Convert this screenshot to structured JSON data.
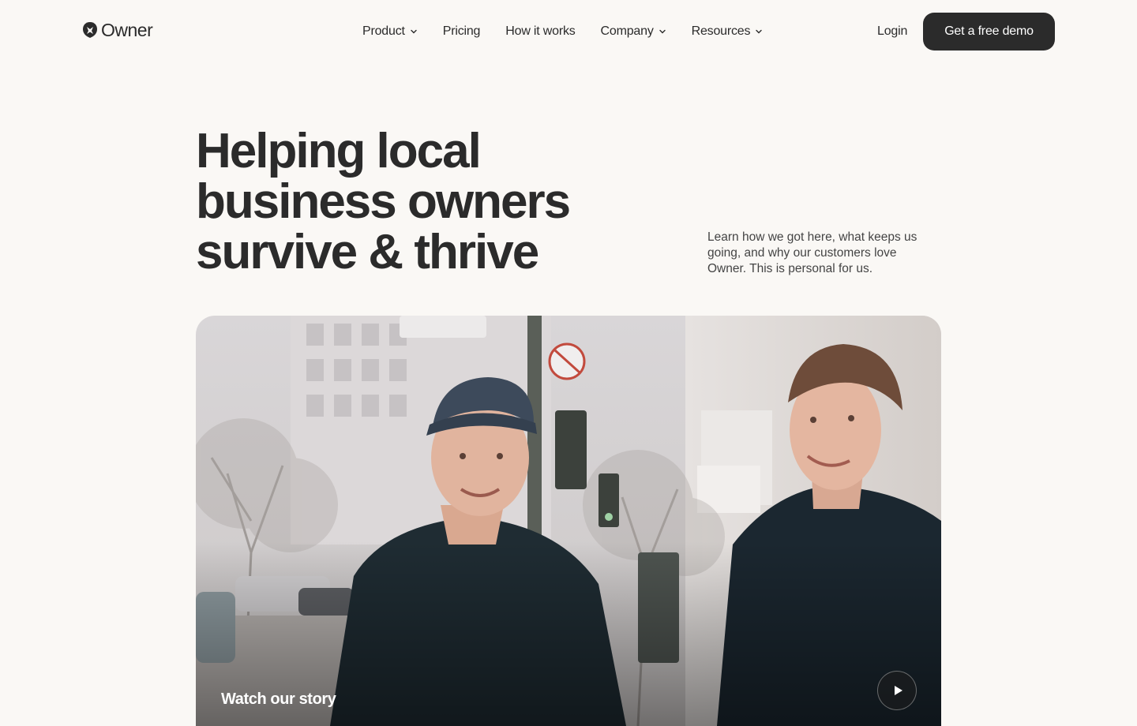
{
  "brand": {
    "name": "Owner"
  },
  "nav": {
    "items": [
      {
        "label": "Product",
        "has_dropdown": true
      },
      {
        "label": "Pricing",
        "has_dropdown": false
      },
      {
        "label": "How it works",
        "has_dropdown": false
      },
      {
        "label": "Company",
        "has_dropdown": true
      },
      {
        "label": "Resources",
        "has_dropdown": true
      }
    ],
    "login_label": "Login",
    "cta_label": "Get a free demo"
  },
  "hero": {
    "title_lines": [
      "Helping local",
      "business owners",
      "survive & thrive"
    ],
    "subtitle": "Learn how we got here, what keeps us going, and why our customers love Owner. This is personal for us."
  },
  "video": {
    "label": "Watch our story",
    "play_icon": "play-icon",
    "image_icon": "founders-photo"
  },
  "colors": {
    "background": "#faf8f5",
    "text": "#2b2b2b",
    "cta_bg": "#2b2b2b",
    "cta_text": "#ffffff"
  }
}
